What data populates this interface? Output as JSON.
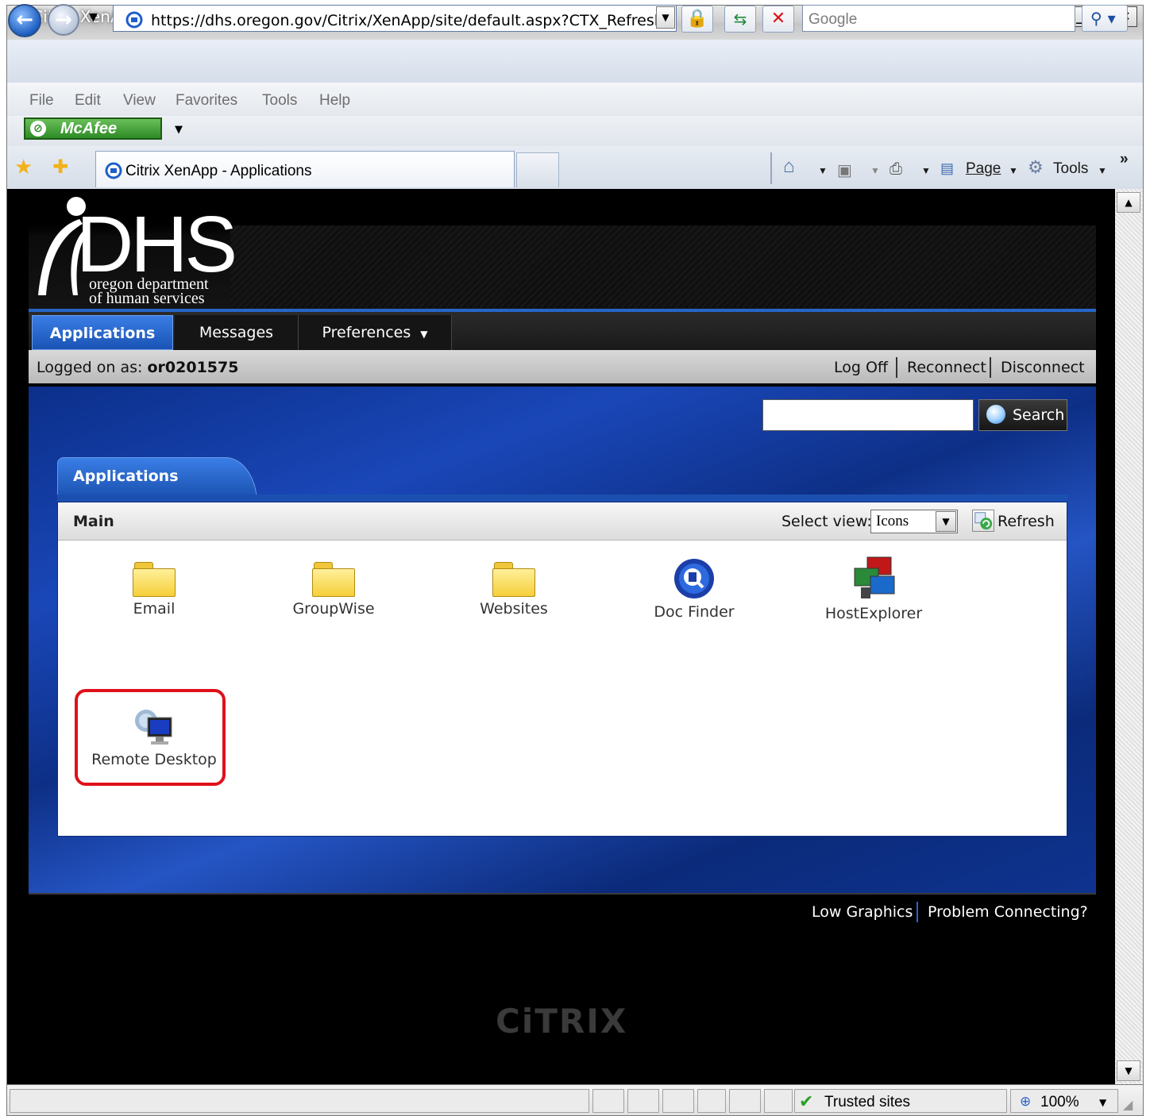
{
  "browser": {
    "window_title": "Citrix XenApp - Applications - Windows Internet Explorer",
    "address": "https://dhs.oregon.gov/Citrix/XenApp/site/default.aspx?CTX_Refresh=On",
    "search_placeholder": "Google",
    "menu": [
      "File",
      "Edit",
      "View",
      "Favorites",
      "Tools",
      "Help"
    ],
    "toolbar_addon": "McAfee",
    "tab_title": "Citrix XenApp - Applications",
    "command_bar": {
      "page": "Page",
      "tools": "Tools",
      "chevron": "»"
    },
    "status": {
      "zone": "Trusted sites",
      "zoom": "100%"
    }
  },
  "site": {
    "logo": {
      "main": "DHS",
      "line1": "oregon department",
      "line2": "of human services"
    },
    "nav": {
      "applications": "Applications",
      "messages": "Messages",
      "preferences": "Preferences"
    },
    "user_bar": {
      "label": "Logged on as:",
      "user": "or0201575",
      "links": {
        "log_off": "Log Off",
        "reconnect": "Reconnect",
        "disconnect": "Disconnect"
      }
    },
    "search_button": "Search",
    "panel": {
      "tab": "Applications",
      "folder": "Main",
      "select_view_label": "Select view:",
      "select_view_value": "Icons",
      "refresh": "Refresh"
    },
    "apps": [
      {
        "label": "Email",
        "icon": "folder-icon"
      },
      {
        "label": "GroupWise",
        "icon": "folder-icon"
      },
      {
        "label": "Websites",
        "icon": "folder-icon"
      },
      {
        "label": "Doc Finder",
        "icon": "doc-finder-icon"
      },
      {
        "label": "HostExplorer",
        "icon": "host-explorer-icon"
      },
      {
        "label": "Remote Desktop",
        "icon": "remote-desktop-icon"
      }
    ],
    "footer": {
      "low_graphics": "Low Graphics",
      "problem": "Problem Connecting?",
      "brand": "CiTRIX"
    }
  },
  "colors": {
    "accent_blue": "#1a52b4",
    "highlight_red": "#e0101a"
  }
}
